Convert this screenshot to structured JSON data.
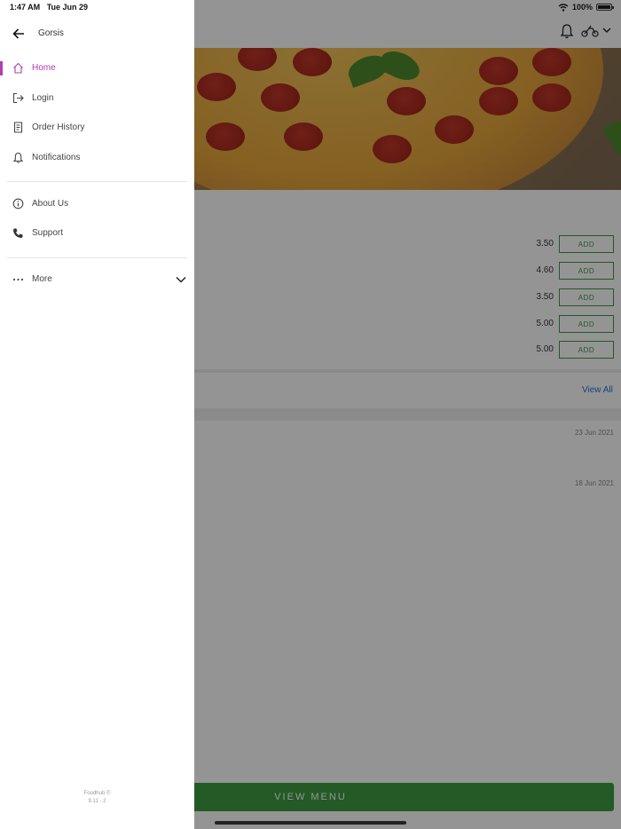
{
  "status_bar": {
    "time": "1:47 AM",
    "date": "Tue Jun 29",
    "battery": "100%",
    "battery_level": 1.0
  },
  "drawer": {
    "title": "Gorsis",
    "items": [
      {
        "label": "Home",
        "icon": "home-icon",
        "active": true
      },
      {
        "label": "Login",
        "icon": "login-icon"
      },
      {
        "label": "Order History",
        "icon": "receipt-icon"
      },
      {
        "label": "Notifications",
        "icon": "bell-icon"
      },
      {
        "label": "About Us",
        "icon": "info-icon"
      },
      {
        "label": "Support",
        "icon": "phone-icon"
      },
      {
        "label": "More",
        "icon": "more-dots-icon"
      }
    ],
    "footer_line1": "Foodhub ©",
    "footer_line2": "9.11 - 2"
  },
  "main": {
    "menu_rows": [
      {
        "price": "3.50",
        "add_label": "ADD"
      },
      {
        "price": "4.60",
        "add_label": "ADD"
      },
      {
        "price": "3.50",
        "add_label": "ADD"
      },
      {
        "price": "5.00",
        "add_label": "ADD"
      },
      {
        "price": "5.00",
        "add_label": "ADD"
      }
    ],
    "view_all": "View All",
    "orders": [
      {
        "date": "23 Jun 2021"
      },
      {
        "date": "18 Jun 2021"
      }
    ],
    "view_menu": "VIEW MENU"
  },
  "colors": {
    "accent": "#b33cb3",
    "brand_green": "#3f9b43",
    "link": "#2277cc"
  }
}
